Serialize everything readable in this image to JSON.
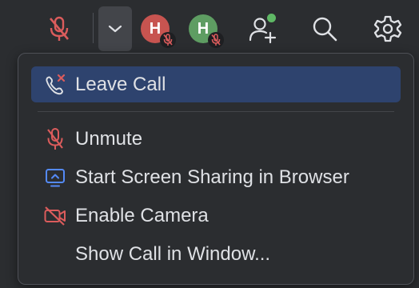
{
  "toolbar": {
    "mute_icon": "microphone-muted-icon",
    "dropdown_icon": "chevron-down-icon",
    "participants": [
      {
        "initial": "H",
        "color": "#c75450",
        "status_icon": "microphone-muted-icon"
      },
      {
        "initial": "H",
        "color": "#5e9d62",
        "status_icon": "microphone-muted-icon"
      }
    ],
    "invite_icon": "add-user-icon",
    "search_icon": "search-icon",
    "settings_icon": "gear-icon"
  },
  "menu": {
    "items": [
      {
        "label": "Leave Call",
        "icon": "phone-hangup-icon",
        "selected": true
      },
      {
        "label": "Unmute",
        "icon": "microphone-muted-icon",
        "selected": false
      },
      {
        "label": "Start Screen Sharing in Browser",
        "icon": "screen-share-icon",
        "selected": false
      },
      {
        "label": "Enable Camera",
        "icon": "camera-off-icon",
        "selected": false
      },
      {
        "label": "Show Call in Window...",
        "icon": "",
        "selected": false
      }
    ]
  },
  "colors": {
    "background": "#2b2d30",
    "selection": "#2e436e",
    "danger": "#db5c5c",
    "accent_blue": "#548af7",
    "online": "#5fb865",
    "text": "#dfe1e5"
  }
}
